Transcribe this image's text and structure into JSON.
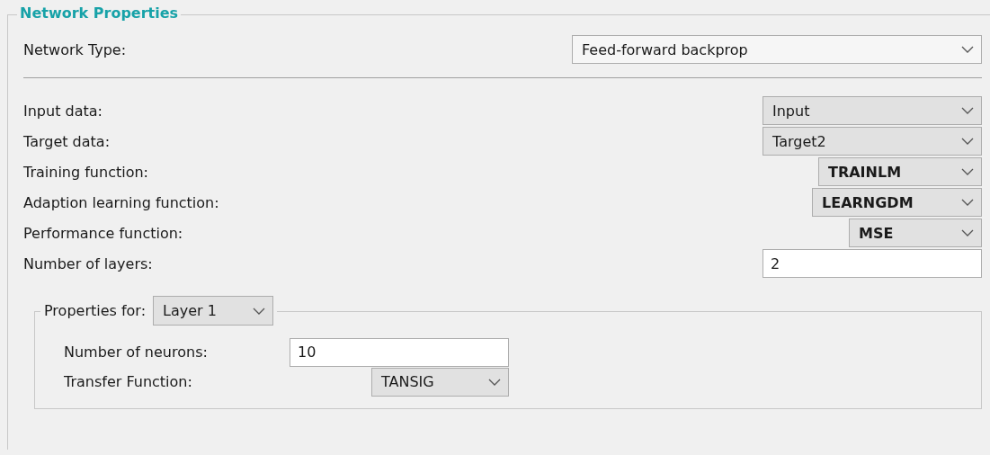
{
  "group": {
    "title": "Network Properties"
  },
  "network_type": {
    "label": "Network Type:",
    "value": "Feed-forward backprop"
  },
  "parameters": [
    {
      "label": "Input data:",
      "kind": "select",
      "value": "Input"
    },
    {
      "label": "Target data:",
      "kind": "select",
      "value": "Target2"
    },
    {
      "label": "Training function:",
      "kind": "select",
      "value": "TRAINLM"
    },
    {
      "label": "Adaption learning function:",
      "kind": "select",
      "value": "LEARNGDM"
    },
    {
      "label": "Performance function:",
      "kind": "select",
      "value": "MSE"
    },
    {
      "label": "Number of layers:",
      "kind": "input",
      "value": "2"
    }
  ],
  "layer_properties": {
    "label": "Properties for:",
    "layer": "Layer 1",
    "fields": [
      {
        "label": "Number of neurons:",
        "kind": "input",
        "value": "10"
      },
      {
        "label": "Transfer Function:",
        "kind": "select",
        "value": "TANSIG"
      }
    ]
  }
}
